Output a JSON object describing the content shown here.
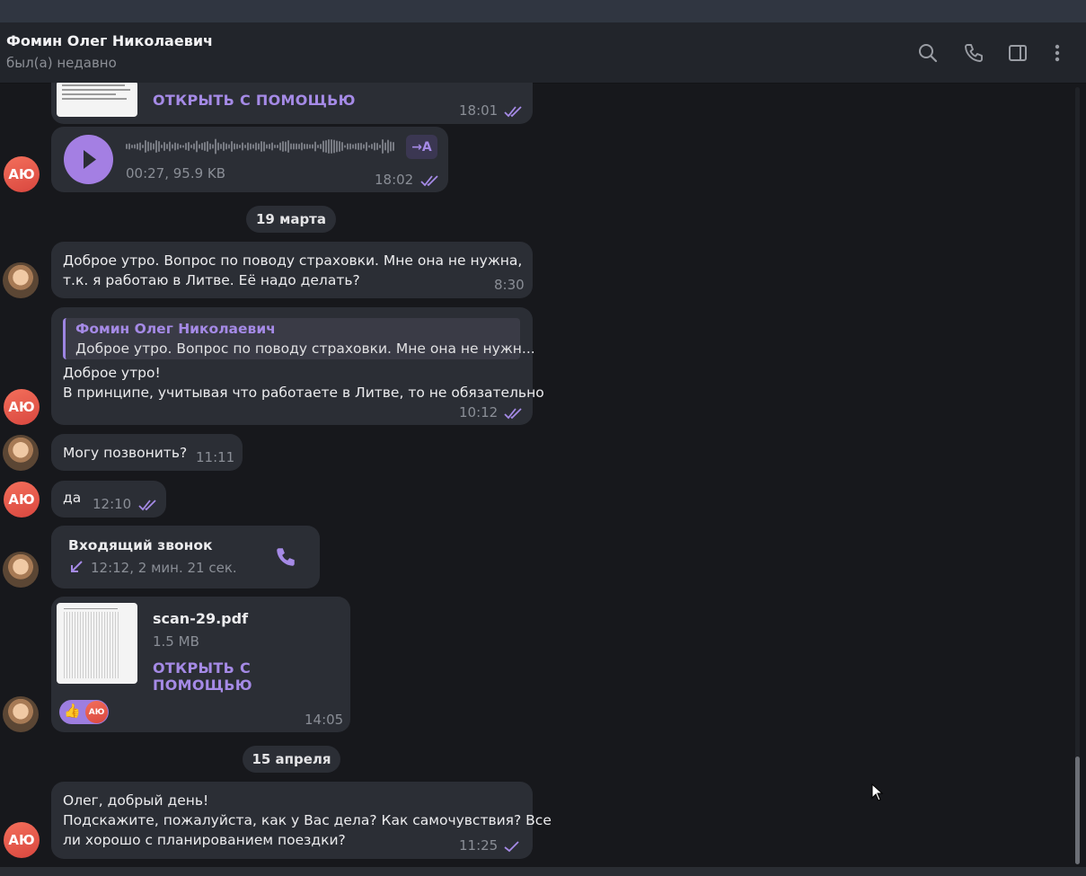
{
  "header": {
    "contact_name": "Фомин Олег Николаевич",
    "status": "был(а) недавно",
    "icons": [
      "search-icon",
      "phone-icon",
      "sidebar-toggle-icon",
      "more-vertical-icon"
    ]
  },
  "avatar_initials": "АЮ",
  "messages": {
    "m1": {
      "link": "ОТКРЫТЬ С ПОМОЩЬЮ",
      "time": "18:01"
    },
    "m2": {
      "duration_size": "00:27, 95.9 KB",
      "transcribe": "→A",
      "time": "18:02"
    },
    "date1": "19 марта",
    "m3": {
      "line1": "Доброе утро. Вопрос по поводу страховки. Мне она не нужна,",
      "line2": "т.к. я работаю в Литве. Её надо делать?",
      "time": "8:30"
    },
    "m4": {
      "reply_author": "Фомин Олег Николаевич",
      "reply_text": "Доброе утро. Вопрос по поводу страховки. Мне она не нужн...",
      "line1": "Доброе утро!",
      "line2": "В принципе, учитывая что работаете в Литве, то не обязательно",
      "time": "10:12"
    },
    "m5": {
      "text": "Могу позвонить?",
      "time": "11:11"
    },
    "m6": {
      "text": "да",
      "time": "12:10"
    },
    "m7": {
      "title": "Входящий звонок",
      "details": "12:12, 2 мин. 21 сек."
    },
    "m8": {
      "filename": "scan-29.pdf",
      "size": "1.5 MB",
      "link": "ОТКРЫТЬ С ПОМОЩЬЮ",
      "reaction": "👍",
      "reaction_user": "АЮ",
      "time": "14:05"
    },
    "date2": "15 апреля",
    "m9": {
      "line1": "Олег, добрый день!",
      "line2": "Подскажите, пожалуйста, как у Вас дела? Как самочувствия? Все",
      "line3": "ли хорошо с планированием поездки?",
      "time": "11:25"
    }
  },
  "colors": {
    "accent": "#a58ae6",
    "bubble": "#2b2e35",
    "background": "#17181c",
    "avatar_au": "#e2564a"
  }
}
